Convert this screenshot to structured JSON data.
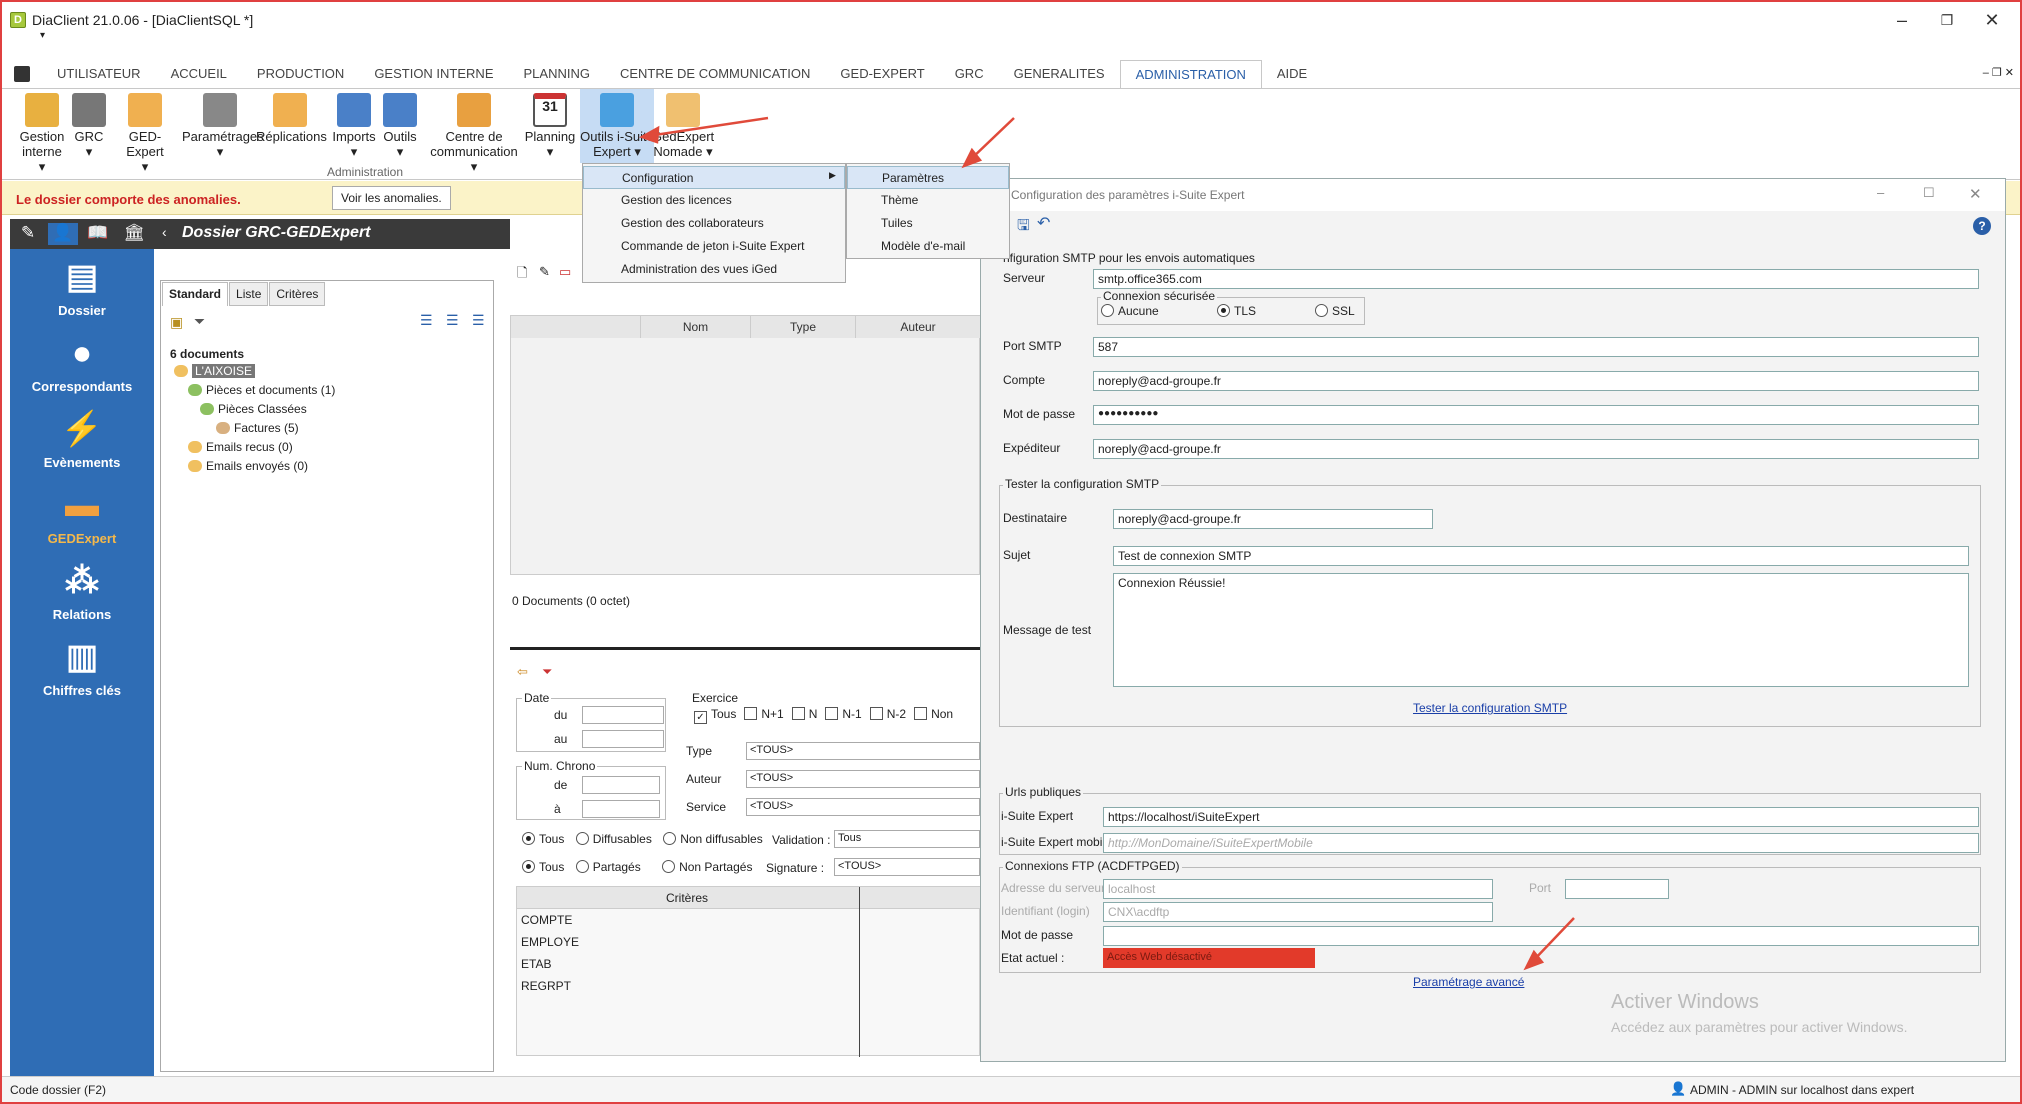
{
  "window": {
    "title": "DiaClient 21.0.06 - [DiaClientSQL *]",
    "app_icon": "D",
    "qat": "▾"
  },
  "menu": {
    "tabs": [
      "UTILISATEUR",
      "ACCUEIL",
      "PRODUCTION",
      "GESTION INTERNE",
      "PLANNING",
      "CENTRE DE COMMUNICATION",
      "GED-EXPERT",
      "GRC",
      "GENERALITES",
      "ADMINISTRATION",
      "AIDE"
    ],
    "active": "ADMINISTRATION"
  },
  "ribbon": {
    "buttons": [
      {
        "l1": "Gestion",
        "l2": "interne ▾",
        "icon": "book-icon"
      },
      {
        "l1": "GRC",
        "l2": "▾",
        "icon": "person-icon"
      },
      {
        "l1": "GED-Expert",
        "l2": "▾",
        "icon": "folder-icon"
      },
      {
        "l1": "Paramétrages",
        "l2": "▾",
        "icon": "gears-icon"
      },
      {
        "l1": "Réplications",
        "l2": "",
        "icon": "folders-icon"
      },
      {
        "l1": "Imports",
        "l2": "▾",
        "icon": "import-icon"
      },
      {
        "l1": "Outils",
        "l2": "▾",
        "icon": "wrench-icon"
      },
      {
        "l1": "Centre de",
        "l2": "communication ▾",
        "icon": "comm-icon"
      },
      {
        "l1": "Planning",
        "l2": "▾",
        "icon": "calendar-icon"
      },
      {
        "l1": "Outils i-Suite",
        "l2": "Expert ▾",
        "icon": "isuite-icon"
      },
      {
        "l1": "GedExpert",
        "l2": "Nomade ▾",
        "icon": "nomade-icon"
      }
    ],
    "calendar_num": "31",
    "group_label": "Administration"
  },
  "anomaly": {
    "text": "Le dossier comporte des anomalies.",
    "button": "Voir les anomalies."
  },
  "dossier_bar": {
    "title": "Dossier GRC-GEDExpert"
  },
  "sidebar": [
    {
      "label": "Dossier",
      "icon": "dossier-icon"
    },
    {
      "label": "Correspondants",
      "icon": "correspondants-icon"
    },
    {
      "label": "Evènements",
      "icon": "lightning-icon"
    },
    {
      "label": "GEDExpert",
      "icon": "gedexpert-folder-icon",
      "active": true
    },
    {
      "label": "Relations",
      "icon": "relations-icon"
    },
    {
      "label": "Chiffres clés",
      "icon": "chart-icon"
    }
  ],
  "tree": {
    "tabs": [
      "Standard",
      "Liste",
      "Critères"
    ],
    "count": "6 documents",
    "nodes": [
      {
        "label": "L'AIXOISE"
      },
      {
        "label": "Pièces et documents (1)"
      },
      {
        "label": "Pièces Classées"
      },
      {
        "label": "Factures (5)"
      },
      {
        "label": "Emails recus (0)"
      },
      {
        "label": "Emails envoyés (0)"
      }
    ]
  },
  "docs": {
    "columns": [
      "Nom",
      "Type",
      "Auteur"
    ],
    "count_text": "0 Documents (0 octet)"
  },
  "filters": {
    "date": "Date",
    "du": "du",
    "au": "au",
    "chrono": "Num. Chrono",
    "de": "de",
    "a": "à",
    "exercice": "Exercice",
    "ex_opts": [
      "Tous",
      "N+1",
      "N",
      "N-1",
      "N-2",
      "Non"
    ],
    "type_l": "Type",
    "type_v": "<TOUS>",
    "auteur_l": "Auteur",
    "auteur_v": "<TOUS>",
    "service_l": "Service",
    "service_v": "<TOUS>",
    "r1": [
      "Tous",
      "Diffusables",
      "Non diffusables"
    ],
    "validation_l": "Validation :",
    "validation_v": "Tous",
    "r2": [
      "Tous",
      "Partagés",
      "Non Partagés"
    ],
    "signature_l": "Signature :",
    "signature_v": "<TOUS>",
    "crit_header": "Critères",
    "criteria": [
      "COMPTE",
      "EMPLOYE",
      "ETAB",
      "REGRPT"
    ]
  },
  "dropdown1": [
    "Configuration",
    "Gestion des licences",
    "Gestion des collaborateurs",
    "Commande de jeton i-Suite Expert",
    "Administration des vues iGed"
  ],
  "dropdown2": [
    "Paramètres",
    "Thème",
    "Tuiles",
    "Modèle d'e-mail"
  ],
  "dialog": {
    "title": "Configuration des paramètres i-Suite Expert",
    "section_smtp": "nfiguration SMTP pour les envois automatiques",
    "serveur_l": "Serveur",
    "serveur_v": "smtp.office365.com",
    "conn_group": "Connexion sécurisée",
    "conn_opts": [
      "Aucune",
      "TLS",
      "SSL"
    ],
    "port_l": "Port SMTP",
    "port_v": "587",
    "compte_l": "Compte",
    "compte_v": "noreply@acd-groupe.fr",
    "mdp_l": "Mot de passe",
    "mdp_v": "●●●●●●●●●●",
    "exp_l": "Expéditeur",
    "exp_v": "noreply@acd-groupe.fr",
    "test_group": "Tester la configuration SMTP",
    "dest_l": "Destinataire",
    "dest_v": "noreply@acd-groupe.fr",
    "sujet_l": "Sujet",
    "sujet_v": "Test de connexion SMTP",
    "msg_l": "Message de test",
    "msg_v": "Connexion  Réussie!",
    "test_link": "Tester la configuration SMTP",
    "urls_group": "Urls publiques",
    "url1_l": "i-Suite Expert",
    "url1_v": "https://localhost/iSuiteExpert",
    "url2_l": "i-Suite Expert mobile",
    "url2_ph": "http://MonDomaine/iSuiteExpertMobile",
    "ftp_group": "Connexions FTP (ACDFTPGED)",
    "addr_l": "Adresse du serveur",
    "addr_v": "localhost",
    "port2_l": "Port",
    "id_l": "Identifiant (login)",
    "id_v": "CNX\\acdftp",
    "ftp_mdp_l": "Mot de passe",
    "etat_l": "Etat actuel :",
    "etat_v": "Accès Web désactivé",
    "adv_link": "Paramétrage avancé"
  },
  "watermark": {
    "l1": "Activer Windows",
    "l2": "Accédez aux paramètres pour activer Windows."
  },
  "status": {
    "left": "Code dossier (F2)",
    "right": "ADMIN - ADMIN sur localhost dans expert"
  },
  "colors": {
    "sidebar": "#2f6db5",
    "accent": "#2a5fa8",
    "anomaly": "#c22222",
    "status_red": "#e23a2a",
    "annotation_arrow": "#e04a3a"
  }
}
